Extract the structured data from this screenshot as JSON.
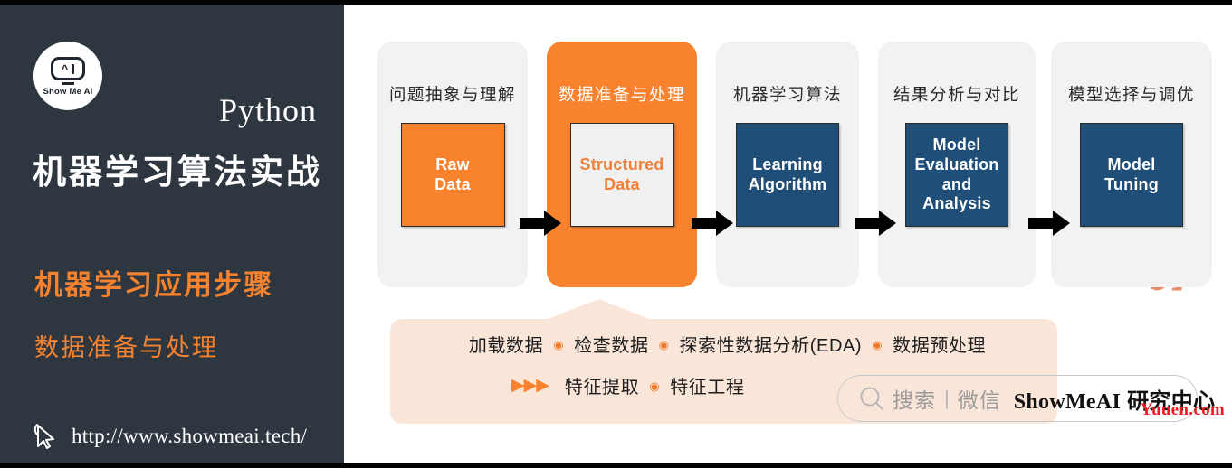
{
  "sidebar": {
    "logo": {
      "icon": "showmeai-robot-logo",
      "eye_left": "^",
      "caption": "Show Me AI"
    },
    "python_title": "Python",
    "course_title": "机器学习算法实战",
    "section_title": "机器学习应用步骤",
    "section_subtitle": "数据准备与处理",
    "url": "http://www.showmeai.tech/",
    "cursor_icon": "mouse-pointer-icon",
    "bg_color": "#2e3640",
    "accent_color": "#f5822e"
  },
  "watermark": {
    "vertical_text": "ShowMeAI",
    "corner_text": "Yuuen.com",
    "corner_color": "#ee1c25"
  },
  "pipeline": {
    "stages": [
      {
        "label": "问题抽象与理解",
        "box_text_lines": [
          "Raw",
          "Data"
        ],
        "box_style": "orange",
        "highlight": false
      },
      {
        "label": "数据准备与处理",
        "box_text_lines": [
          "Structured",
          "Data"
        ],
        "box_style": "white",
        "highlight": true
      },
      {
        "label": "机器学习算法",
        "box_text_lines": [
          "Learning",
          "Algorithm"
        ],
        "box_style": "blue",
        "highlight": false
      },
      {
        "label": "结果分析与对比",
        "box_text_lines": [
          "Model",
          "Evaluation",
          "and",
          "Analysis"
        ],
        "box_style": "blue",
        "highlight": false
      },
      {
        "label": "模型选择与调优",
        "box_text_lines": [
          "Model",
          "Tuning"
        ],
        "box_style": "blue",
        "highlight": false
      }
    ],
    "arrow_icon": "right-arrow-icon",
    "highlight_color": "#f9822f",
    "blue_color": "#1f4e79",
    "stage_bg": "#f2f2f2"
  },
  "callout": {
    "separator": "◉",
    "triangles": "▶▶▶",
    "row1": [
      "加载数据",
      "检查数据",
      "探索性数据分析(EDA)",
      "数据预处理"
    ],
    "row2": [
      "特征提取",
      "特征工程"
    ],
    "bg_color": "#fae6d9"
  },
  "search": {
    "icon": "search-icon",
    "placeholder": "搜索",
    "divider": "|",
    "channel": "微信",
    "brand": "ShowMeAI",
    "brand_cn": " 研究中心"
  }
}
